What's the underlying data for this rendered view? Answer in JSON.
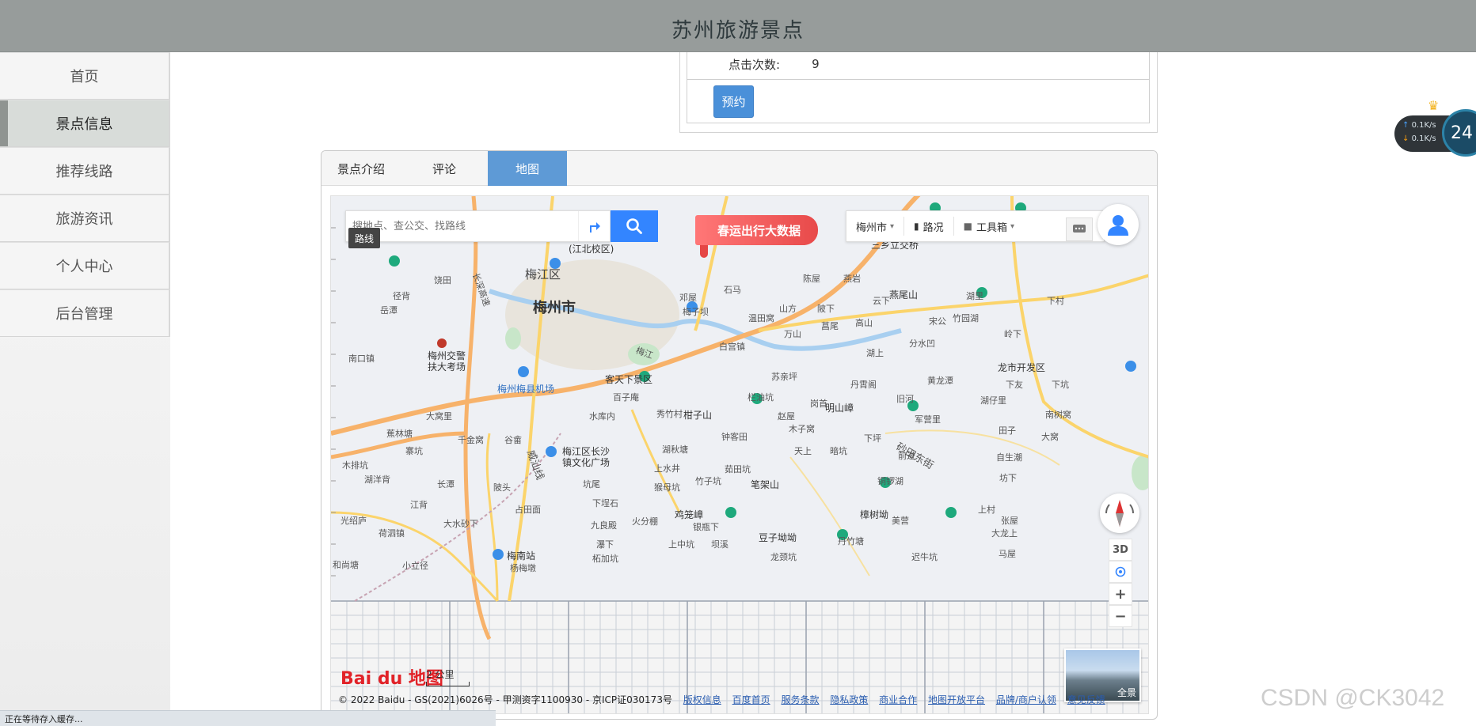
{
  "header": {
    "title": "苏州旅游景点"
  },
  "sidebar": {
    "items": [
      {
        "label": "首页",
        "active": false
      },
      {
        "label": "景点信息",
        "active": true
      },
      {
        "label": "推荐线路",
        "active": false
      },
      {
        "label": "旅游资讯",
        "active": false
      },
      {
        "label": "个人中心",
        "active": false
      },
      {
        "label": "后台管理",
        "active": false
      }
    ]
  },
  "info": {
    "clicks_label": "点击次数:",
    "clicks_value": "9",
    "reserve_label": "预约"
  },
  "tabs": [
    {
      "label": "景点介绍",
      "active": false
    },
    {
      "label": "评论",
      "active": false
    },
    {
      "label": "地图",
      "active": true
    }
  ],
  "map": {
    "search_placeholder": "搜地点、查公交、找路线",
    "route_tag": "路线",
    "promo": "春运出行大数据",
    "city": "梅州市",
    "traffic": "路况",
    "toolbox": "工具箱",
    "btn_3d": "3D",
    "zoom_in": "+",
    "zoom_out": "−",
    "logo": "Bai du 地图",
    "scale": "2 公里",
    "panorama_label": "全景",
    "copyright": "© 2022 Baidu - GS(2021)6026号 - 甲测资字1100930 - 京ICP证030173号",
    "links": [
      "版权信息",
      "百度首页",
      "服务条款",
      "隐私政策",
      "商业合作",
      "地图开放平台",
      "品牌/商户认领",
      "意见反馈"
    ],
    "places": {
      "city_main": "梅州市",
      "district": "梅江区",
      "airport": "梅州梅县机场",
      "kejia": "客天下景区",
      "tangzi": "柑子山",
      "mingshan": "明山嶂",
      "bijia": "笔架山",
      "jilong": "鸡笼嶂",
      "douzi": "豆子坳坳",
      "zhangshu": "樟树坳",
      "yanwei": "燕尾山",
      "sanxiang": "三乡立交桥",
      "longshi": "龙市开发区",
      "meinan": "梅南站",
      "changsha": "梅江区长沙镇文化广场",
      "jiaojing": "梅州交警扶大考场",
      "jiangbei": "(江北校区)",
      "nankou": "南口镇",
      "road1": "长深高速",
      "road2": "梅江",
      "road3": "砂田东街",
      "road4": "威汕线",
      "v1": "岳潭",
      "v2": "径背",
      "v3": "饶田",
      "v4": "大窝里",
      "v5": "蕉林塘",
      "v6": "寨坑",
      "v7": "木排坑",
      "v8": "湖洋背",
      "v9": "千金窝",
      "v10": "谷畲",
      "v11": "长潭",
      "v12": "陂头",
      "v13": "占田面",
      "v14": "下埕石",
      "v15": "九良殿",
      "v16": "火分棚",
      "v17": "上中坑",
      "v18": "银瓶下",
      "v19": "龙颈坑",
      "v20": "丹竹塘",
      "v21": "美营",
      "v22": "迟牛坑",
      "v23": "马屋",
      "v24": "大龙上",
      "v25": "上村",
      "v26": "张屋",
      "v27": "自生潮",
      "v28": "坊下",
      "v29": "田子",
      "v30": "大窝",
      "v31": "南树窝",
      "v32": "湖仔里",
      "v33": "下友",
      "v34": "下坑",
      "v35": "黄龙潭",
      "v36": "旧河",
      "v37": "军营里",
      "v38": "前进",
      "v39": "铜锣湖",
      "v40": "下坪",
      "v41": "木子窝",
      "v42": "天上",
      "v43": "暗坑",
      "v44": "赵屋",
      "v45": "岗首",
      "v46": "丹霄阁",
      "v47": "苏亲坪",
      "v48": "钟客田",
      "v49": "茹田坑",
      "v50": "竹子坑",
      "v51": "上水井",
      "v52": "猴母坑",
      "v53": "湖秋塘",
      "v54": "秀竹村",
      "v55": "水库内",
      "v56": "百子庵",
      "v57": "白宫镇",
      "v58": "万山",
      "v59": "山方",
      "v60": "温田窝",
      "v61": "陂下",
      "v62": "菖尾",
      "v63": "高山",
      "v64": "宋公",
      "v65": "分水凹",
      "v66": "湖上",
      "v67": "竹园湖",
      "v68": "岭下",
      "v69": "湖里",
      "v70": "下村",
      "v71": "云下",
      "v72": "燕岩",
      "v73": "陈屋",
      "v74": "邓屋",
      "v75": "梅子坝",
      "v76": "石马",
      "v77": "栏油坑",
      "v78": "坑尾",
      "v79": "瀑下",
      "v80": "柘加坑",
      "v81": "杨梅墩",
      "v82": "小立径",
      "v83": "大水砂下",
      "v84": "荷泗镇",
      "v85": "光绍庐",
      "v86": "江背",
      "v87": "和尚塘",
      "v88": "坝溪"
    }
  },
  "netspeed": {
    "up": "0.1K/s",
    "down": "0.1K/s",
    "percent": "24"
  },
  "watermark": "CSDN @CK3042",
  "statusbar": "正在等待存入缓存..."
}
